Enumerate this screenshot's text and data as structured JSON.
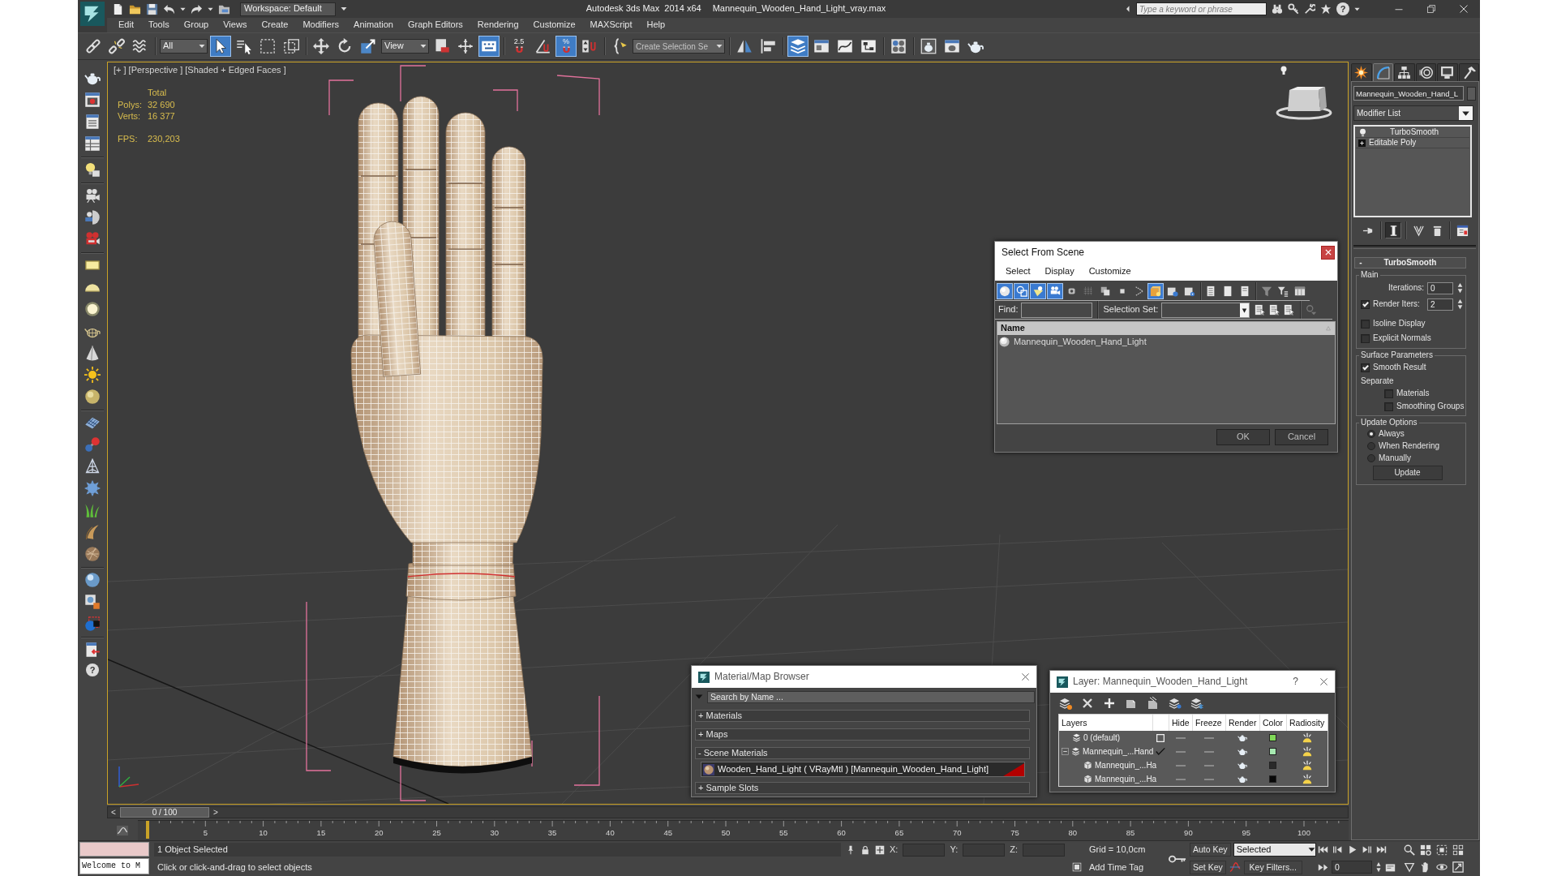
{
  "window": {
    "app_title": "Autodesk 3ds Max  2014 x64",
    "file_name": "Mannequin_Wooden_Hand_Light_vray.max",
    "workspace": "Workspace: Default"
  },
  "info_center": {
    "search": {
      "placeholder": "Type a keyword or phrase"
    },
    "help": "?"
  },
  "menu": [
    "Edit",
    "Tools",
    "Group",
    "Views",
    "Create",
    "Modifiers",
    "Animation",
    "Graph Editors",
    "Rendering",
    "Customize",
    "MAXScript",
    "Help"
  ],
  "main_toolbar": [
    [
      {
        "kind": "link",
        "on": false
      },
      {
        "kind": "unlink",
        "on": false
      },
      {
        "kind": "bind",
        "on": false
      }
    ],
    [
      {
        "kind": "dropdown",
        "value": "All"
      },
      {
        "kind": "select",
        "on": true
      },
      {
        "kind": "select-by-name",
        "on": false
      },
      {
        "kind": "region",
        "on": false
      },
      {
        "kind": "crossing",
        "on": false
      }
    ],
    [
      {
        "kind": "move",
        "on": false
      },
      {
        "kind": "rotate",
        "on": false
      },
      {
        "kind": "scale",
        "on": false
      },
      {
        "kind": "dropdown",
        "value": "View"
      },
      {
        "kind": "pivot",
        "on": false
      },
      {
        "kind": "manipulate",
        "on": false
      },
      {
        "kind": "override",
        "on": true
      }
    ],
    [
      {
        "kind": "snap",
        "label": "2.5",
        "on": false
      },
      {
        "kind": "angle-snap",
        "on": false
      },
      {
        "kind": "percent-snap",
        "label": "%",
        "on": true
      },
      {
        "kind": "spinner-snap",
        "on": false
      }
    ],
    [
      {
        "kind": "named-sets",
        "on": false
      },
      {
        "kind": "combo",
        "placeholder": "Create Selection Se"
      }
    ],
    [
      {
        "kind": "mirror",
        "on": false
      },
      {
        "kind": "align",
        "on": false
      }
    ],
    [
      {
        "kind": "layers",
        "on": true
      },
      {
        "kind": "ribbon",
        "on": false
      },
      {
        "kind": "curves",
        "on": false
      },
      {
        "kind": "schematic",
        "on": false
      }
    ],
    [
      {
        "kind": "material-editor",
        "on": false
      }
    ],
    [
      {
        "kind": "render-setup",
        "on": false
      },
      {
        "kind": "frame-window",
        "on": false
      },
      {
        "kind": "render",
        "on": false
      }
    ]
  ],
  "left_toolbar": {
    "help": "?"
  },
  "viewport": {
    "active": true,
    "labels": [
      "[+ ]",
      "[Perspective ]",
      "[Shaded + Edged Faces ]"
    ],
    "stats": {
      "heading": "Total",
      "rows": [
        {
          "label": "Polys:",
          "value": "32 690"
        },
        {
          "label": "Verts:",
          "value": "16 377"
        }
      ],
      "fps": {
        "label": "FPS:",
        "value": "230,203"
      }
    }
  },
  "command_panel": {
    "tabs": [
      {
        "kind": "create",
        "selected": false
      },
      {
        "kind": "modify",
        "selected": true
      },
      {
        "kind": "hierarchy",
        "selected": false
      },
      {
        "kind": "motion",
        "selected": false
      },
      {
        "kind": "display",
        "selected": false
      },
      {
        "kind": "utilities",
        "selected": false
      }
    ],
    "object_name": "Mannequin_Wooden_Hand_L",
    "modifier_list": "Modifier List",
    "stack": [
      {
        "kind": "modifier",
        "label": "TurboSmooth"
      },
      {
        "kind": "base",
        "label": "Editable Poly"
      }
    ],
    "stack_buttons": [
      {
        "kind": "pin",
        "on": false
      },
      {
        "kind": "end-result",
        "on": true
      },
      {
        "kind": "unique",
        "on": false
      },
      {
        "kind": "remove",
        "on": false
      },
      {
        "kind": "configure",
        "on": false
      }
    ],
    "rollout": {
      "sign": "-",
      "title": "TurboSmooth",
      "groups": [
        {
          "title": "Main",
          "controls": [
            {
              "kind": "spinner",
              "label": "Iterations:",
              "value": "0"
            },
            {
              "kind": "check-spinner",
              "label": "Render Iters:",
              "checked": true,
              "value": "2"
            },
            {
              "kind": "checkbox",
              "label": "Isoline Display",
              "checked": false
            },
            {
              "kind": "checkbox",
              "label": "Explicit Normals",
              "checked": false
            }
          ]
        },
        {
          "title": "Surface Parameters",
          "controls": [
            {
              "kind": "checkbox",
              "label": "Smooth Result",
              "checked": true
            },
            {
              "kind": "text",
              "label": "Separate"
            },
            {
              "kind": "subcheck",
              "label": "Materials",
              "checked": false
            },
            {
              "kind": "subcheck",
              "label": "Smoothing Groups",
              "checked": false
            }
          ]
        },
        {
          "title": "Update Options",
          "controls": [
            {
              "kind": "radio",
              "label": "Always",
              "selected": true
            },
            {
              "kind": "radio",
              "label": "When Rendering",
              "selected": false
            },
            {
              "kind": "radio",
              "label": "Manually",
              "selected": false
            },
            {
              "kind": "button",
              "label": "Update"
            }
          ]
        }
      ]
    }
  },
  "select_dialog": {
    "title": "Select From Scene",
    "menu": [
      "Select",
      "Display",
      "Customize"
    ],
    "toolbar": [
      [
        {
          "kind": "geometry",
          "on": true
        },
        {
          "kind": "shapes",
          "on": true
        },
        {
          "kind": "lights",
          "on": true
        },
        {
          "kind": "cameras",
          "on": true
        },
        {
          "kind": "helpers",
          "on": false
        },
        {
          "kind": "space-warps",
          "on": false
        },
        {
          "kind": "groups",
          "on": false
        },
        {
          "kind": "xrefs",
          "on": false
        },
        {
          "kind": "bones",
          "on": false
        },
        {
          "kind": "containers",
          "on": true
        },
        {
          "kind": "frozen",
          "on": false
        },
        {
          "kind": "hidden",
          "on": false
        }
      ],
      [
        {
          "kind": "select-all",
          "on": false
        },
        {
          "kind": "select-none",
          "on": false
        },
        {
          "kind": "invert",
          "on": false
        }
      ],
      [
        {
          "kind": "filter",
          "on": false
        },
        {
          "kind": "filter-list",
          "on": false
        },
        {
          "kind": "columns",
          "on": false
        }
      ]
    ],
    "find": {
      "label": "Find:"
    },
    "selection_set": {
      "label": "Selection Set:"
    },
    "columns": [
      "Name"
    ],
    "rows": [
      {
        "name": "Mannequin_Wooden_Hand_Light"
      }
    ],
    "buttons": [
      "OK",
      "Cancel"
    ]
  },
  "material_browser": {
    "title": "Material/Map Browser",
    "search": {
      "placeholder": "Search by Name ..."
    },
    "sections": [
      {
        "label": "+ Materials"
      },
      {
        "label": "+ Maps"
      },
      {
        "label": "- Scene Materials",
        "items": [
          {
            "label": "Wooden_Hand_Light ( VRayMtl ) [Mannequin_Wooden_Hand_Light]"
          }
        ]
      },
      {
        "label": "+ Sample Slots"
      }
    ]
  },
  "layer_dialog": {
    "title": "Layer: Mannequin_Wooden_Hand_Light",
    "help": "?",
    "columns": [
      "Layers",
      "Hide",
      "Freeze",
      "Render",
      "Color",
      "Radiosity"
    ],
    "rows": [
      {
        "name": "0 (default)",
        "current": false,
        "color": "#7fd857"
      },
      {
        "name": "Mannequin_...Hand",
        "current": true,
        "expanded": true,
        "color": "#a6e8b0",
        "children": [
          {
            "name": "Mannequin_...Ha",
            "color": "#2a2a2a"
          },
          {
            "name": "Mannequin_...Ha",
            "color": "#080808"
          }
        ]
      }
    ]
  },
  "time_slider": {
    "prev": "<",
    "label": "0 / 100",
    "next": ">",
    "level": 0
  },
  "track_bar": {
    "ticks": [
      "5",
      "10",
      "15",
      "20",
      "25",
      "30",
      "35",
      "40",
      "45",
      "50",
      "55",
      "60",
      "65",
      "70",
      "75",
      "80",
      "85",
      "90",
      "95",
      "100"
    ]
  },
  "status_bar": {
    "listener_output": "Welcome to M",
    "selection": "1 Object Selected",
    "prompt": "Click or click-and-drag to select objects",
    "coordinates": [
      "X:",
      "Y:",
      "Z:"
    ],
    "grid": "Grid = 10,0cm",
    "time_tag": "Add Time Tag",
    "auto_key": "Auto Key",
    "set_key": "Set Key",
    "key_mode": "Selected",
    "key_filters": "Key Filters...",
    "frame": "0"
  }
}
